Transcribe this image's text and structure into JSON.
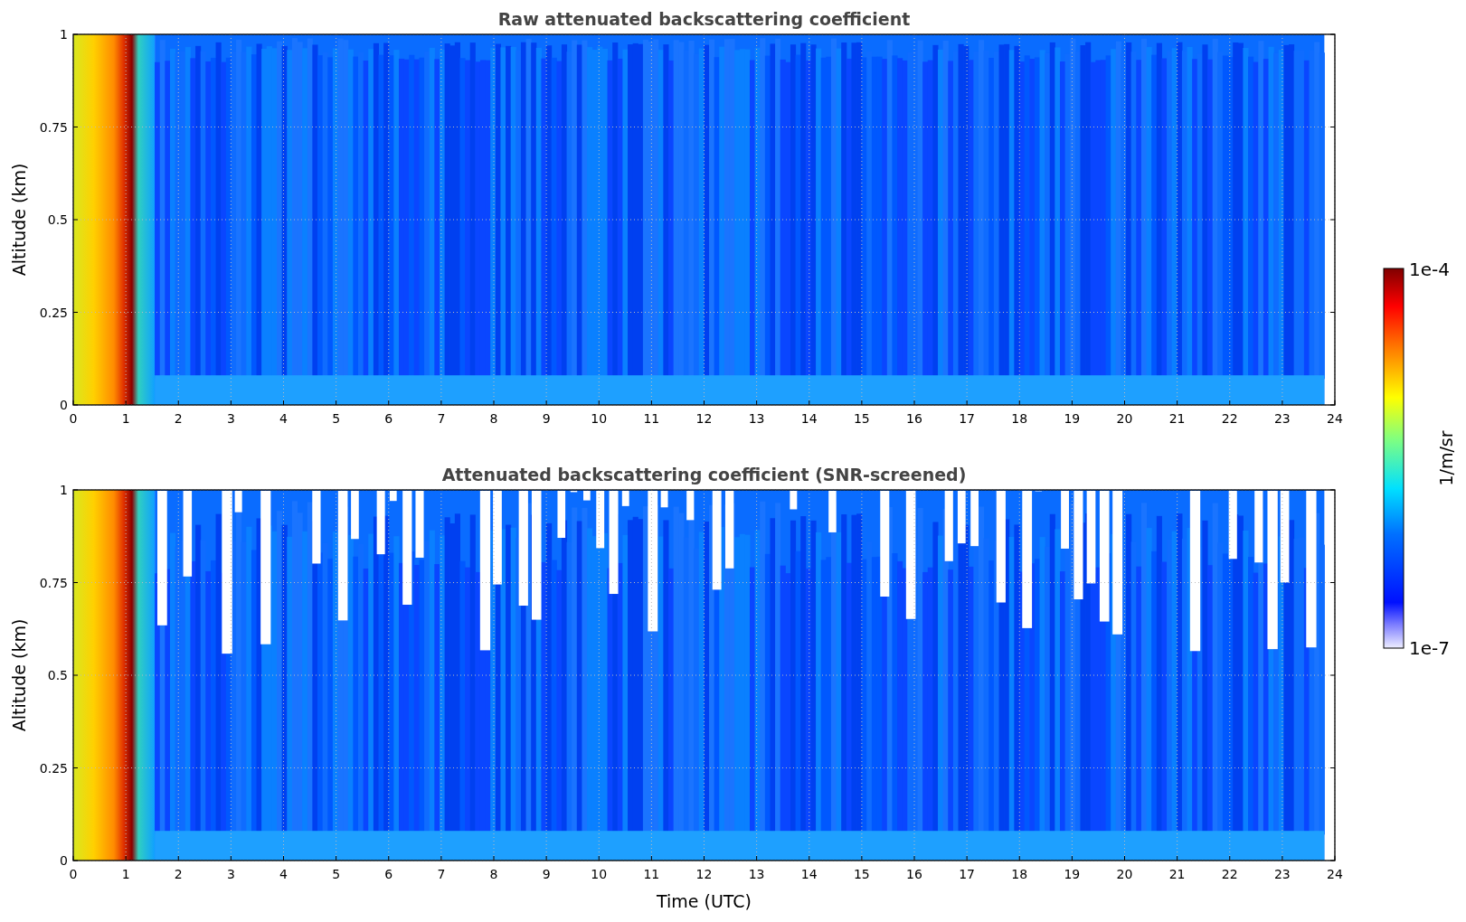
{
  "figure": {
    "panels": [
      {
        "title": "Raw attenuated backscattering coefficient",
        "ylabel": "Altitude (km)",
        "yticks": [
          "1",
          "0.75",
          "0.5",
          "0.25",
          "0"
        ],
        "xticks": [
          "0",
          "1",
          "2",
          "3",
          "4",
          "5",
          "6",
          "7",
          "8",
          "9",
          "10",
          "11",
          "12",
          "13",
          "14",
          "15",
          "16",
          "17",
          "18",
          "19",
          "20",
          "21",
          "22",
          "23",
          "24"
        ],
        "screened": false
      },
      {
        "title": "Attenuated backscattering coefficient (SNR-screened)",
        "ylabel": "Altitude (km)",
        "yticks": [
          "1",
          "0.75",
          "0.5",
          "0.25",
          "0"
        ],
        "xticks": [
          "0",
          "1",
          "2",
          "3",
          "4",
          "5",
          "6",
          "7",
          "8",
          "9",
          "10",
          "11",
          "12",
          "13",
          "14",
          "15",
          "16",
          "17",
          "18",
          "19",
          "20",
          "21",
          "22",
          "23",
          "24"
        ],
        "xlabel": "Time (UTC)",
        "screened": true
      }
    ],
    "colorbar": {
      "max_label": "1e-4",
      "min_label": "1e-7",
      "label": "1/m/sr"
    }
  }
}
